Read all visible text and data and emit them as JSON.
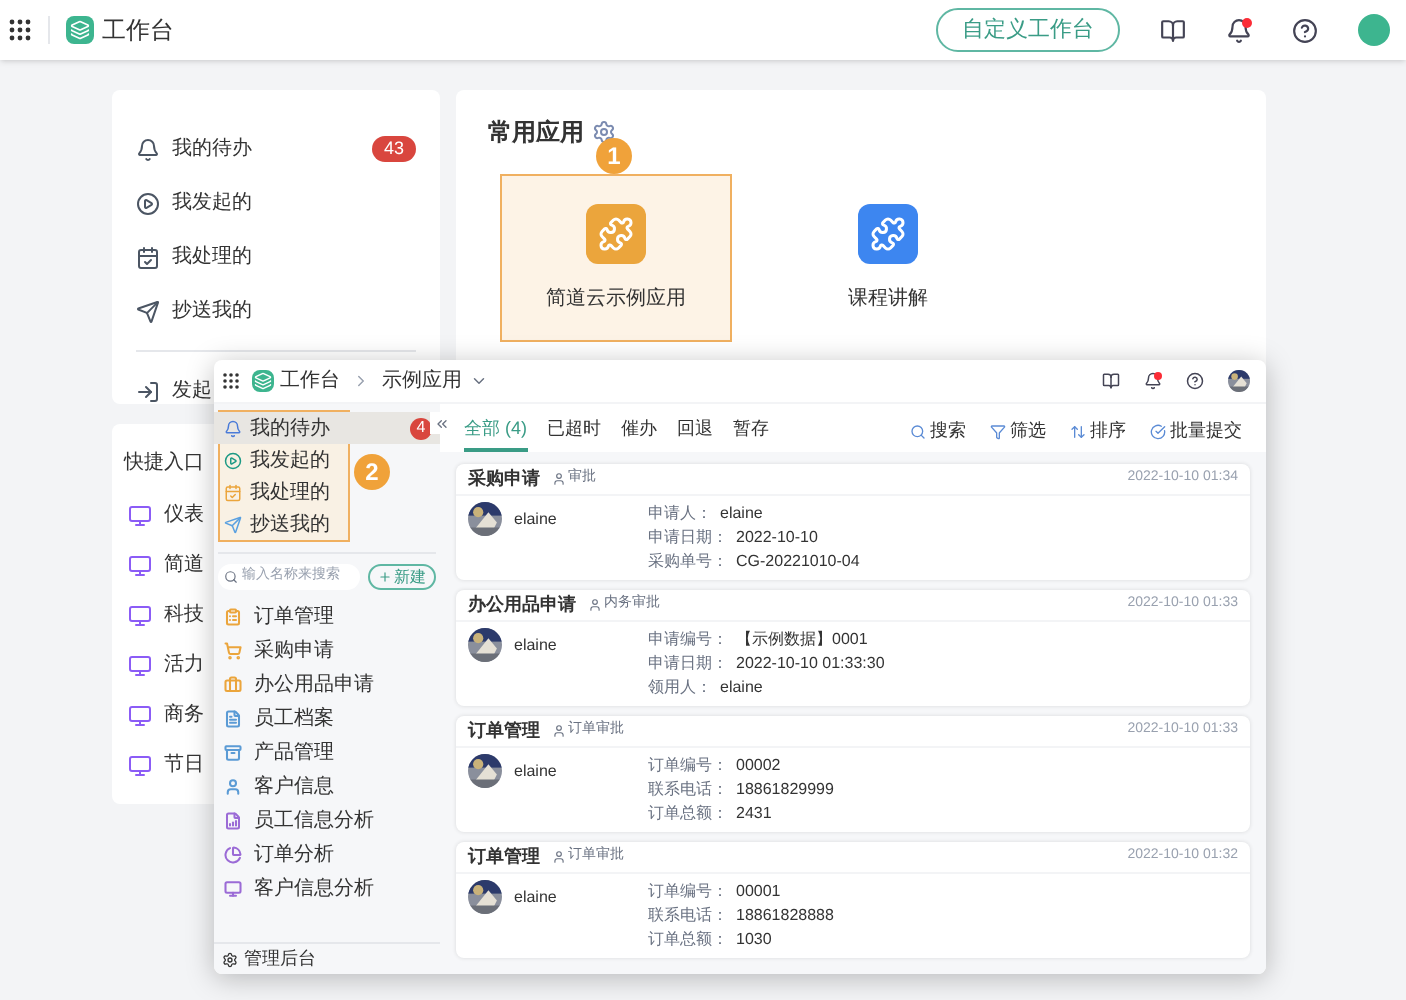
{
  "topbar": {
    "title": "工作台",
    "customize_button": "自定义工作台"
  },
  "my_panel": {
    "items": [
      {
        "kind": "todo",
        "label": "我的待办",
        "badge": "43"
      },
      {
        "kind": "started",
        "label": "我发起的"
      },
      {
        "kind": "handled",
        "label": "我处理的"
      },
      {
        "kind": "cc",
        "label": "抄送我的"
      },
      {
        "kind": "launch",
        "label": "发起"
      }
    ]
  },
  "shortcuts": {
    "title": "快捷入口",
    "items": [
      "仪表",
      "简道",
      "科技",
      "活力",
      "商务",
      "节日"
    ]
  },
  "common_apps": {
    "title": "常用应用",
    "callout": "1",
    "apps": [
      {
        "label": "简道云示例应用",
        "color": "#eba53c",
        "highlighted": true
      },
      {
        "label": "课程讲解",
        "color": "#3d86f0",
        "highlighted": false
      }
    ]
  },
  "inset": {
    "breadcrumb": [
      "工作台",
      "示例应用"
    ],
    "sidebar": {
      "callout": "2",
      "items": [
        {
          "kind": "todo",
          "label": "我的待办",
          "badge": "4",
          "selected": true
        },
        {
          "kind": "started",
          "label": "我发起的",
          "selected": false
        },
        {
          "kind": "handled",
          "label": "我处理的",
          "selected": false
        },
        {
          "kind": "cc",
          "label": "抄送我的",
          "selected": false
        }
      ],
      "search": {
        "placeholder": "输入名称来搜索"
      },
      "new_button": "新建",
      "apps": [
        {
          "kind": "doc",
          "label": "订单管理",
          "color": "#eba53c"
        },
        {
          "kind": "cart",
          "label": "采购申请",
          "color": "#eba53c"
        },
        {
          "kind": "bag",
          "label": "办公用品申请",
          "color": "#eba53c"
        },
        {
          "kind": "file",
          "label": "员工档案",
          "color": "#5b9bd5"
        },
        {
          "kind": "box",
          "label": "产品管理",
          "color": "#5b9bd5"
        },
        {
          "kind": "user",
          "label": "客户信息",
          "color": "#5b9bd5"
        },
        {
          "kind": "report",
          "label": "员工信息分析",
          "color": "#9b6bd6"
        },
        {
          "kind": "pie",
          "label": "订单分析",
          "color": "#9b6bd6"
        },
        {
          "kind": "screen",
          "label": "客户信息分析",
          "color": "#9b6bd6"
        }
      ],
      "footer": "管理后台"
    },
    "tabs": [
      {
        "label": "全部 (4)",
        "selected": true
      },
      {
        "label": "已超时",
        "selected": false
      },
      {
        "label": "催办",
        "selected": false
      },
      {
        "label": "回退",
        "selected": false
      },
      {
        "label": "暂存",
        "selected": false
      }
    ],
    "actions": [
      {
        "kind": "search",
        "label": "搜索"
      },
      {
        "kind": "filter",
        "label": "筛选"
      },
      {
        "kind": "sort",
        "label": "排序"
      },
      {
        "kind": "batch",
        "label": "批量提交"
      }
    ],
    "cards": [
      {
        "title": "采购申请",
        "type": "审批",
        "time": "2022-10-10 01:34",
        "user": "elaine",
        "fields": [
          {
            "label": "申请人：",
            "value": "elaine"
          },
          {
            "label": "申请日期：",
            "value": "2022-10-10"
          },
          {
            "label": "采购单号：",
            "value": "CG-20221010-04"
          }
        ]
      },
      {
        "title": "办公用品申请",
        "type": "内务审批",
        "time": "2022-10-10 01:33",
        "user": "elaine",
        "fields": [
          {
            "label": "申请编号：",
            "value": "【示例数据】0001"
          },
          {
            "label": "申请日期：",
            "value": "2022-10-10 01:33:30"
          },
          {
            "label": "领用人：",
            "value": "elaine"
          }
        ]
      },
      {
        "title": "订单管理",
        "type": "订单审批",
        "time": "2022-10-10 01:33",
        "user": "elaine",
        "fields": [
          {
            "label": "订单编号：",
            "value": "00002"
          },
          {
            "label": "联系电话：",
            "value": "18861829999"
          },
          {
            "label": "订单总额：",
            "value": "2431"
          }
        ]
      },
      {
        "title": "订单管理",
        "type": "订单审批",
        "time": "2022-10-10 01:32",
        "user": "elaine",
        "fields": [
          {
            "label": "订单编号：",
            "value": "00001"
          },
          {
            "label": "联系电话：",
            "value": "18861828888"
          },
          {
            "label": "订单总额：",
            "value": "1030"
          }
        ]
      }
    ]
  }
}
